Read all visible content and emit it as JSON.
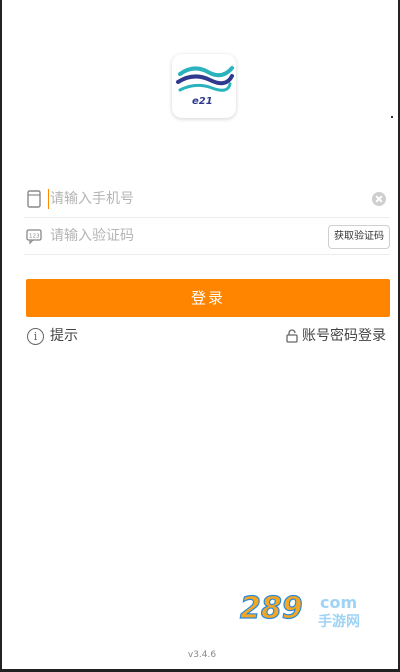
{
  "logo": {
    "text": "e21"
  },
  "phone": {
    "placeholder": "请输入手机号"
  },
  "code": {
    "placeholder": "请输入验证码",
    "button_label": "获取验证码"
  },
  "login": {
    "label": "登录"
  },
  "tip": {
    "icon_glyph": "i",
    "label": "提示"
  },
  "account_login": {
    "label": "账号密码登录"
  },
  "watermark": {
    "number": "289",
    "suffix": "com",
    "text": "手游网"
  },
  "version": "v3.4.6",
  "colors": {
    "accent": "#ff8400",
    "logo_teal": "#2bb3bd",
    "logo_navy": "#2f3a8f"
  },
  "icons": [
    "phone-icon",
    "sms-code-icon",
    "clear-icon",
    "info-icon",
    "lock-icon"
  ]
}
